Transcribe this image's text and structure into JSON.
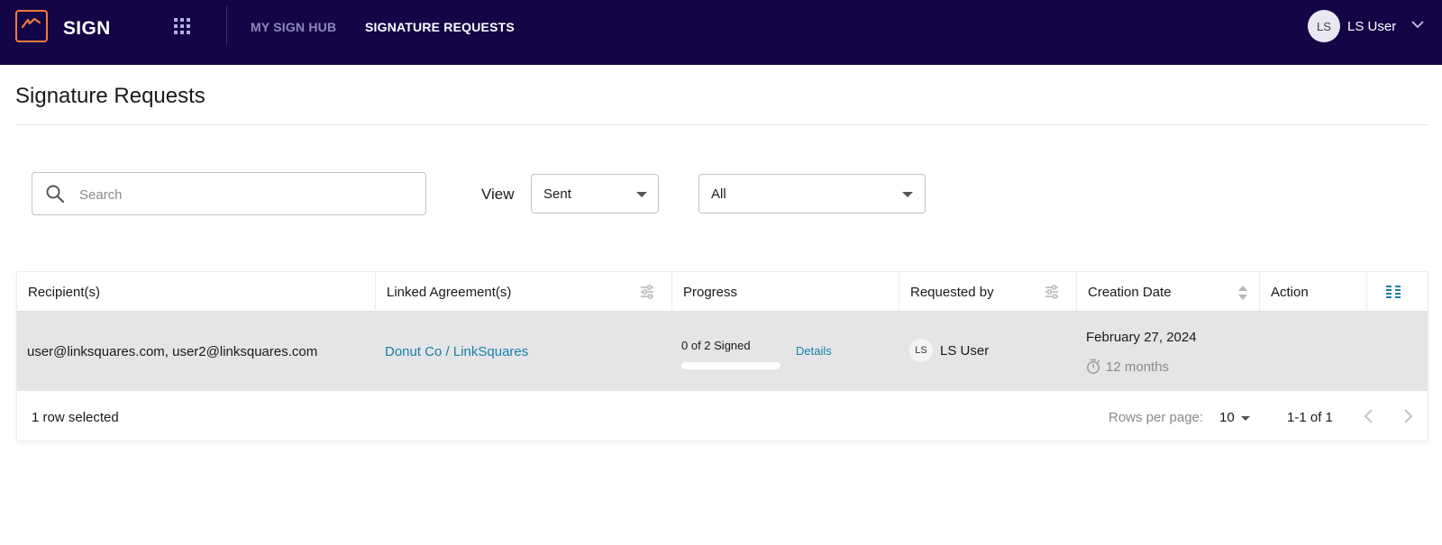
{
  "app": {
    "brand": "SIGN"
  },
  "nav": {
    "hub": "MY SIGN HUB",
    "requests": "SIGNATURE REQUESTS"
  },
  "user": {
    "initials": "LS",
    "name": "LS User"
  },
  "page": {
    "title": "Signature Requests"
  },
  "filters": {
    "search_placeholder": "Search",
    "view_label": "View",
    "view_value": "Sent",
    "status_value": "All"
  },
  "table": {
    "columns": [
      {
        "label": "Recipient(s)"
      },
      {
        "label": "Linked Agreement(s)"
      },
      {
        "label": "Progress"
      },
      {
        "label": "Requested by"
      },
      {
        "label": "Creation Date"
      },
      {
        "label": "Action"
      }
    ],
    "rows": [
      {
        "recipients": "user@linksquares.com, user2@linksquares.com",
        "agreement": "Donut Co / LinkSquares",
        "progress_text": "0 of 2 Signed",
        "progress_fraction": 0,
        "details": "Details",
        "requester_initials": "LS",
        "requester_name": "LS User",
        "date": "February 27, 2024",
        "age": "12 months"
      }
    ],
    "footer": {
      "selected": "1 row selected",
      "rows_per_page_label": "Rows per page:",
      "rows_per_page": "10",
      "range": "1-1 of 1"
    }
  },
  "colors": {
    "topbar": "#140546",
    "logo_accent": "#f07a3c",
    "link": "#1a7fa7",
    "row_selected": "#e5e5e7"
  },
  "icons": [
    "sign-logo-icon",
    "apps-grid-icon",
    "chevron-down-icon",
    "search-icon",
    "tune-icon",
    "sort-icon",
    "columns-icon",
    "timer-icon",
    "chevron-left-icon",
    "chevron-right-icon"
  ]
}
